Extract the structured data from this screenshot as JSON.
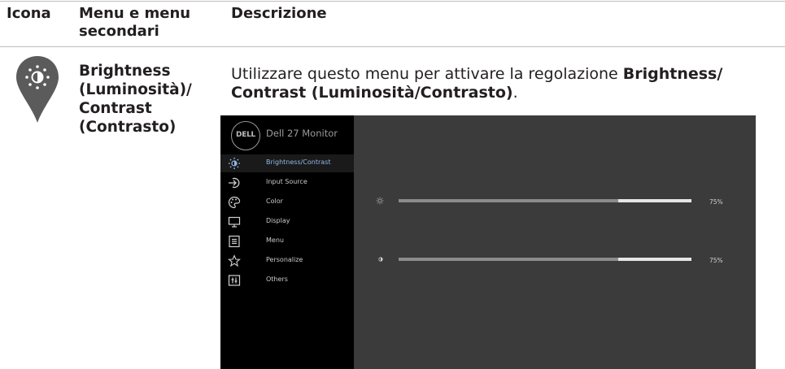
{
  "headers": {
    "icon": "Icona",
    "menu": "Menu e menu secondari",
    "description": "Descrizione"
  },
  "row": {
    "icon_name": "brightness-pin-icon",
    "item_name": "Brightness (Luminosità)/ Contrast (Contrasto)",
    "description_prefix": "Utilizzare questo menu per attivare la regolazione ",
    "description_bold": "Brightness/ Contrast (Luminosità/Contrasto)",
    "description_suffix": "."
  },
  "osd": {
    "logo": "DELL",
    "title": "Dell 27 Monitor",
    "menu_items": [
      {
        "label": "Brightness/Contrast",
        "icon": "brightness-icon",
        "selected": true
      },
      {
        "label": "Input Source",
        "icon": "input-source-icon",
        "selected": false
      },
      {
        "label": "Color",
        "icon": "color-palette-icon",
        "selected": false
      },
      {
        "label": "Display",
        "icon": "display-icon",
        "selected": false
      },
      {
        "label": "Menu",
        "icon": "menu-icon",
        "selected": false
      },
      {
        "label": "Personalize",
        "icon": "star-icon",
        "selected": false
      },
      {
        "label": "Others",
        "icon": "others-icon",
        "selected": false
      }
    ],
    "sliders": [
      {
        "name": "brightness",
        "icon": "brightness-small-icon",
        "value": 75,
        "label": "75%"
      },
      {
        "name": "contrast",
        "icon": "contrast-small-icon",
        "value": 75,
        "label": "75%"
      }
    ]
  },
  "colors": {
    "text": "#231f20",
    "pin": "#5b5b5b",
    "osd_bg": "#3b3b3b",
    "osd_sidebar": "#000000",
    "selected_text": "#8fb8e6"
  }
}
